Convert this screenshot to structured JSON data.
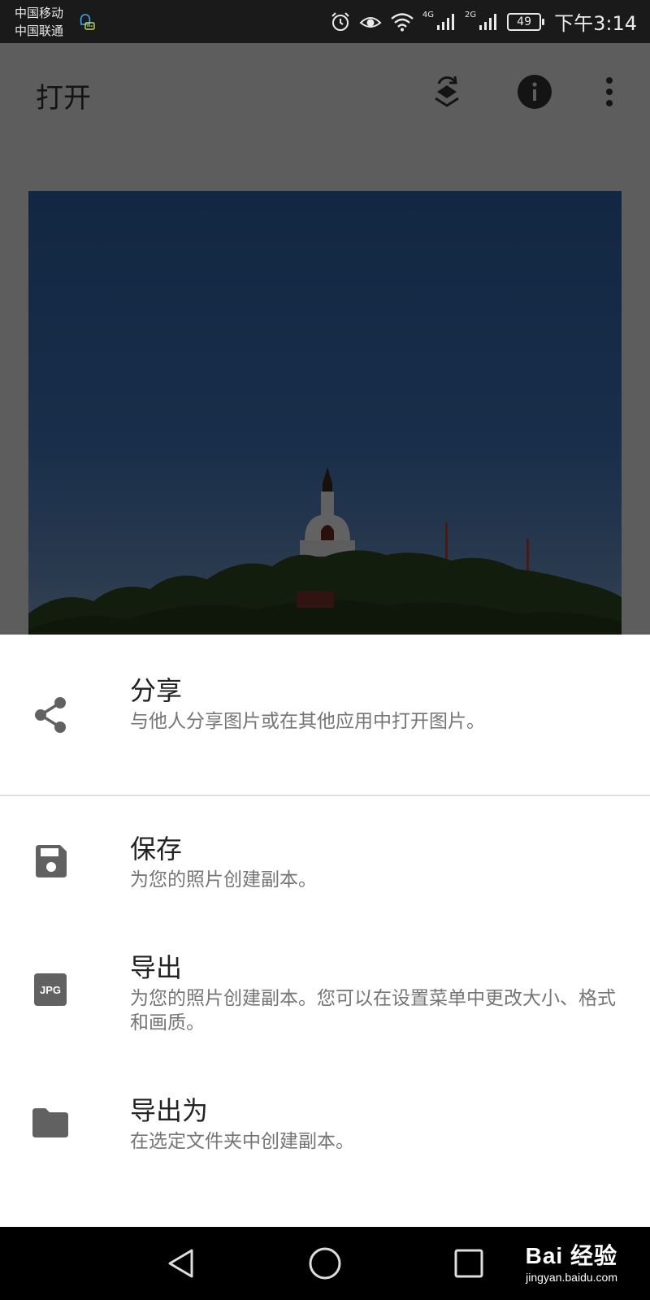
{
  "status_bar": {
    "carrier_1": "中国移动",
    "carrier_2": "中国联通",
    "network_1": "4G",
    "network_2": "2G",
    "battery": "49",
    "time": "下午3:14"
  },
  "toolbar": {
    "title": "打开"
  },
  "sheet": {
    "items": [
      {
        "icon": "share-icon",
        "title": "分享",
        "desc": "与他人分享图片或在其他应用中打开图片。"
      },
      {
        "icon": "save-icon",
        "title": "保存",
        "desc": "为您的照片创建副本。"
      },
      {
        "icon": "jpg-icon",
        "title": "导出",
        "desc": "为您的照片创建副本。您可以在设置菜单中更改大小、格式和画质。",
        "badge": "JPG"
      },
      {
        "icon": "folder-icon",
        "title": "导出为",
        "desc": "在选定文件夹中创建副本。"
      }
    ]
  },
  "watermark": {
    "brand": "Bai 经验",
    "url": "jingyan.baidu.com"
  },
  "colors": {
    "sheet_bg": "#ffffff",
    "icon_gray": "#616161",
    "title_text": "#222222",
    "desc_text": "#757575"
  }
}
